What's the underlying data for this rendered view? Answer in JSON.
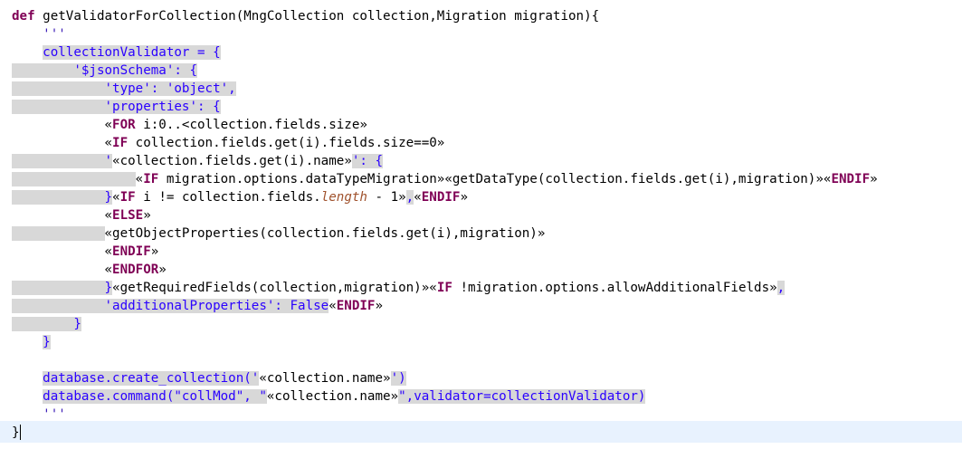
{
  "editor": {
    "language": "xtend-template",
    "colors": {
      "keyword": "#7f0055",
      "string": "#2a00ff",
      "template_region": "#d8d8d8",
      "current_line": "#e8f2fe"
    },
    "lines": [
      [
        {
          "t": "def",
          "c": "kw"
        },
        {
          "t": " getValidatorForCollection(MngCollection collection,Migration migration){"
        }
      ],
      [
        {
          "t": "    "
        },
        {
          "t": "'''",
          "c": "sq"
        }
      ],
      [
        {
          "t": "    "
        },
        {
          "t": "collectionValidator = {",
          "c": "str bg"
        }
      ],
      [
        {
          "t": "    ",
          "c": "bg"
        },
        {
          "t": "    '$jsonSchema': {",
          "c": "str bg"
        }
      ],
      [
        {
          "t": "    ",
          "c": "bg"
        },
        {
          "t": "        'type': 'object',",
          "c": "str bg"
        }
      ],
      [
        {
          "t": "    ",
          "c": "bg"
        },
        {
          "t": "        'properties': {",
          "c": "str bg"
        }
      ],
      [
        {
          "t": "            "
        },
        {
          "t": "«"
        },
        {
          "t": "FOR",
          "c": "kw"
        },
        {
          "t": " i:0..<collection.fields.size»"
        }
      ],
      [
        {
          "t": "            "
        },
        {
          "t": "«"
        },
        {
          "t": "IF",
          "c": "kw"
        },
        {
          "t": " collection.fields.get(i).fields.size==0»"
        }
      ],
      [
        {
          "t": "    ",
          "c": "bg"
        },
        {
          "t": "        ",
          "c": "bg"
        },
        {
          "t": "'",
          "c": "str bg"
        },
        {
          "t": "«collection.fields.get(i).name»"
        },
        {
          "t": "': {",
          "c": "str bg"
        }
      ],
      [
        {
          "t": "    ",
          "c": "bg"
        },
        {
          "t": "            ",
          "c": "bg"
        },
        {
          "t": "«"
        },
        {
          "t": "IF",
          "c": "kw"
        },
        {
          "t": " migration.options.dataTypeMigration»«getDataType(collection.fields.get(i),migration)»«"
        },
        {
          "t": "ENDIF",
          "c": "kw"
        },
        {
          "t": "»"
        }
      ],
      [
        {
          "t": "    ",
          "c": "bg"
        },
        {
          "t": "        ",
          "c": "bg"
        },
        {
          "t": "}",
          "c": "str bg"
        },
        {
          "t": "«"
        },
        {
          "t": "IF",
          "c": "kw"
        },
        {
          "t": " i != collection.fields."
        },
        {
          "t": "length",
          "c": "it"
        },
        {
          "t": " - 1»"
        },
        {
          "t": ",",
          "c": "str bg"
        },
        {
          "t": "«"
        },
        {
          "t": "ENDIF",
          "c": "kw"
        },
        {
          "t": "»"
        }
      ],
      [
        {
          "t": "            "
        },
        {
          "t": "«"
        },
        {
          "t": "ELSE",
          "c": "kw"
        },
        {
          "t": "»"
        }
      ],
      [
        {
          "t": "    ",
          "c": "bg"
        },
        {
          "t": "        ",
          "c": "bg"
        },
        {
          "t": "«getObjectProperties(collection.fields.get(i),migration)»"
        }
      ],
      [
        {
          "t": "            "
        },
        {
          "t": "«"
        },
        {
          "t": "ENDIF",
          "c": "kw"
        },
        {
          "t": "»"
        }
      ],
      [
        {
          "t": "            "
        },
        {
          "t": "«"
        },
        {
          "t": "ENDFOR",
          "c": "kw"
        },
        {
          "t": "»"
        }
      ],
      [
        {
          "t": "    ",
          "c": "bg"
        },
        {
          "t": "    ",
          "c": "bg"
        },
        {
          "t": "    }",
          "c": "str bg"
        },
        {
          "t": "«getRequiredFields(collection,migration)»«"
        },
        {
          "t": "IF",
          "c": "kw"
        },
        {
          "t": " !migration.options.allowAdditionalFields»"
        },
        {
          "t": ",",
          "c": "str bg"
        }
      ],
      [
        {
          "t": "    ",
          "c": "bg"
        },
        {
          "t": "        'additionalProperties': False",
          "c": "str bg"
        },
        {
          "t": "«"
        },
        {
          "t": "ENDIF",
          "c": "kw"
        },
        {
          "t": "»"
        }
      ],
      [
        {
          "t": "    ",
          "c": "bg"
        },
        {
          "t": "    }",
          "c": "str bg"
        }
      ],
      [
        {
          "t": "    "
        },
        {
          "t": "}",
          "c": "str bg"
        }
      ],
      [
        {
          "t": ""
        }
      ],
      [
        {
          "t": "    "
        },
        {
          "t": "database.create_collection('",
          "c": "str bg"
        },
        {
          "t": "«collection.name»"
        },
        {
          "t": "')",
          "c": "str bg"
        }
      ],
      [
        {
          "t": "    "
        },
        {
          "t": "database.command(\"collMod\", \"",
          "c": "str bg"
        },
        {
          "t": "«collection.name»"
        },
        {
          "t": "\",validator=collectionValidator)",
          "c": "str bg"
        }
      ],
      [
        {
          "t": "    "
        },
        {
          "t": "'''",
          "c": "sq"
        }
      ],
      [
        {
          "t": "}"
        }
      ]
    ]
  }
}
